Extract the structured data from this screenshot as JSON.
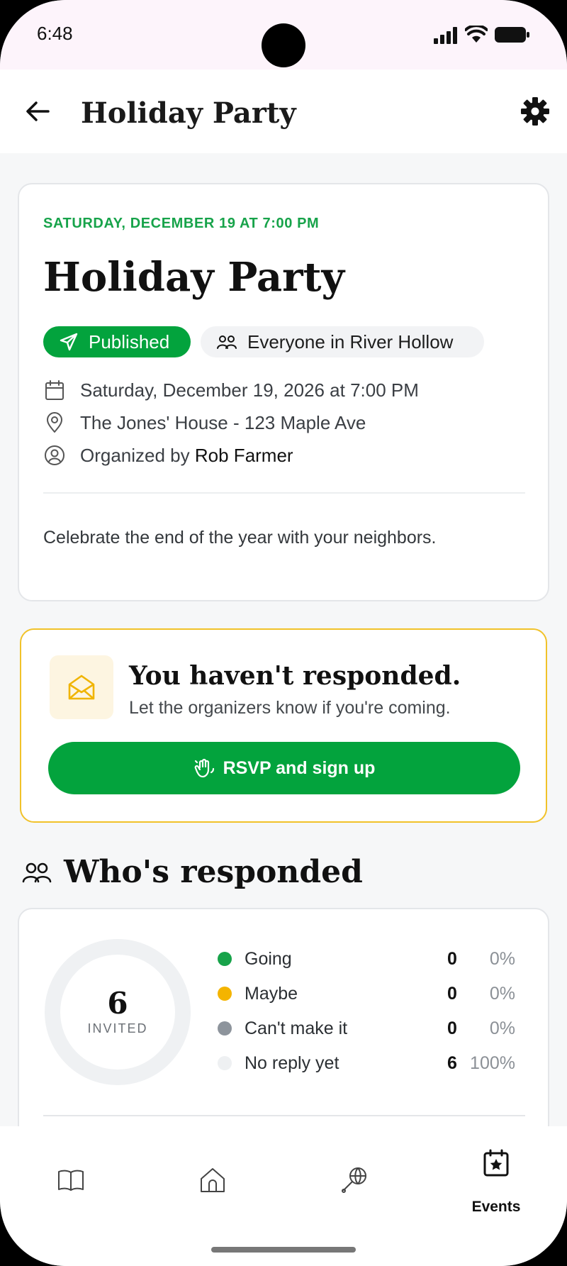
{
  "status_bar": {
    "time": "6:48"
  },
  "app_bar": {
    "title": "Holiday Party"
  },
  "event": {
    "overline": "SATURDAY, DECEMBER 19 AT 7:00 PM",
    "title": "Holiday Party",
    "status_badge": "Published",
    "audience": "Everyone in River Hollow",
    "datetime": "Saturday, December 19, 2026 at 7:00 PM",
    "location": "The Jones' House - 123 Maple Ave",
    "organizer_prefix": "Organized by",
    "organizer_name": "Rob Farmer",
    "description": "Celebrate the end of the year with your neighbors."
  },
  "rsvp": {
    "heading": "You haven't responded.",
    "subtext": "Let the organizers know if you're coming.",
    "button_label": "RSVP and sign up"
  },
  "responses": {
    "title": "Who's responded",
    "invited_count": "6",
    "invited_label": "INVITED",
    "stats": [
      {
        "label": "Going",
        "count": "0",
        "percent": "0%",
        "color": "#17a34a"
      },
      {
        "label": "Maybe",
        "count": "0",
        "percent": "0%",
        "color": "#f4b400"
      },
      {
        "label": "Can't make it",
        "count": "0",
        "percent": "0%",
        "color": "#8d949c"
      },
      {
        "label": "No reply yet",
        "count": "6",
        "percent": "100%",
        "color": "#eef0f2"
      }
    ]
  },
  "bottom_nav": {
    "items": [
      {
        "icon": "book-icon",
        "label": ""
      },
      {
        "icon": "home-icon",
        "label": ""
      },
      {
        "icon": "globe-pin-icon",
        "label": ""
      },
      {
        "icon": "calendar-star-icon",
        "label": "Events",
        "active": true
      }
    ]
  },
  "colors": {
    "accent": "#03a33d",
    "warning": "#f1c22a",
    "background": "#f6f7f8"
  }
}
